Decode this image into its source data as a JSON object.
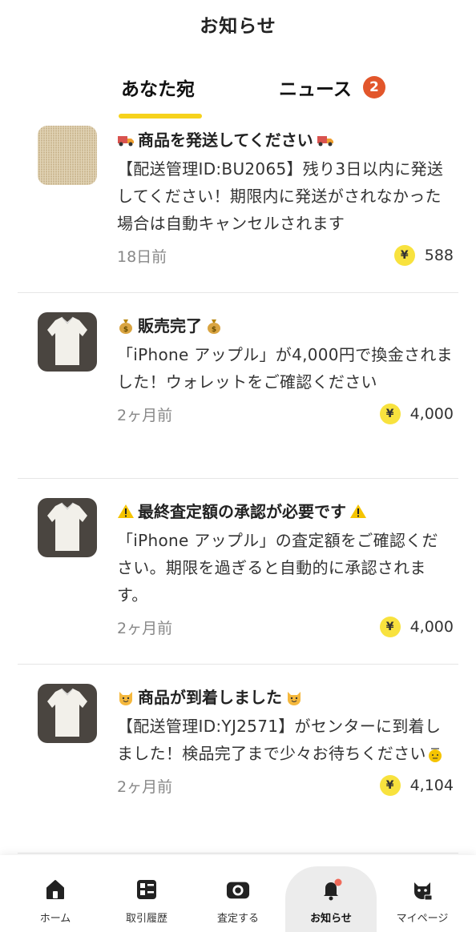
{
  "header": {
    "title": "お知らせ"
  },
  "tabs": {
    "you_label": "あなた宛",
    "news_label": "ニュース",
    "news_badge": "2"
  },
  "notifications": [
    {
      "title": "商品を発送してください",
      "title_icon": "truck-icon",
      "body": "【配送管理ID:BU2065】残り3日以内に発送してください！期限内に発送がされなかった場合は自動キャンセルされます",
      "time": "18日前",
      "currency": "¥",
      "amount": "588",
      "thumb": "fabric-thumbnail"
    },
    {
      "title": "販売完了",
      "title_icon": "money-bag-icon",
      "body": "「iPhone アップル」が4,000円で換金されました！ウォレットをご確認ください",
      "time": "2ヶ月前",
      "currency": "¥",
      "amount": "4,000",
      "thumb": "white-blouse-thumbnail"
    },
    {
      "title": "最終査定額の承認が必要です",
      "title_icon": "warning-icon",
      "body": "「iPhone アップル」の査定額をご確認ください。期限を過ぎると自動的に承認されます。",
      "time": "2ヶ月前",
      "currency": "¥",
      "amount": "4,000",
      "thumb": "white-blouse-thumbnail"
    },
    {
      "title": "商品が到着しました",
      "title_icon": "smiling-cat-icon",
      "body": "【配送管理ID:YJ2571】がセンターに到着しました！検品完了まで少々お待ちください",
      "time": "2ヶ月前",
      "currency": "¥",
      "amount": "4,104",
      "thumb": "white-blouse-thumbnail"
    }
  ],
  "bottom_nav": [
    {
      "label": "ホーム",
      "icon": "home-icon",
      "active": false
    },
    {
      "label": "取引履歴",
      "icon": "transactions-icon",
      "active": false
    },
    {
      "label": "査定する",
      "icon": "camera-icon",
      "active": false
    },
    {
      "label": "お知らせ",
      "icon": "bell-icon",
      "active": true
    },
    {
      "label": "マイページ",
      "icon": "cat-profile-icon",
      "active": false
    }
  ],
  "colors": {
    "accent_yellow": "#f6d21c",
    "badge_orange": "#e2562b",
    "yen_yellow": "#f8e23e"
  }
}
